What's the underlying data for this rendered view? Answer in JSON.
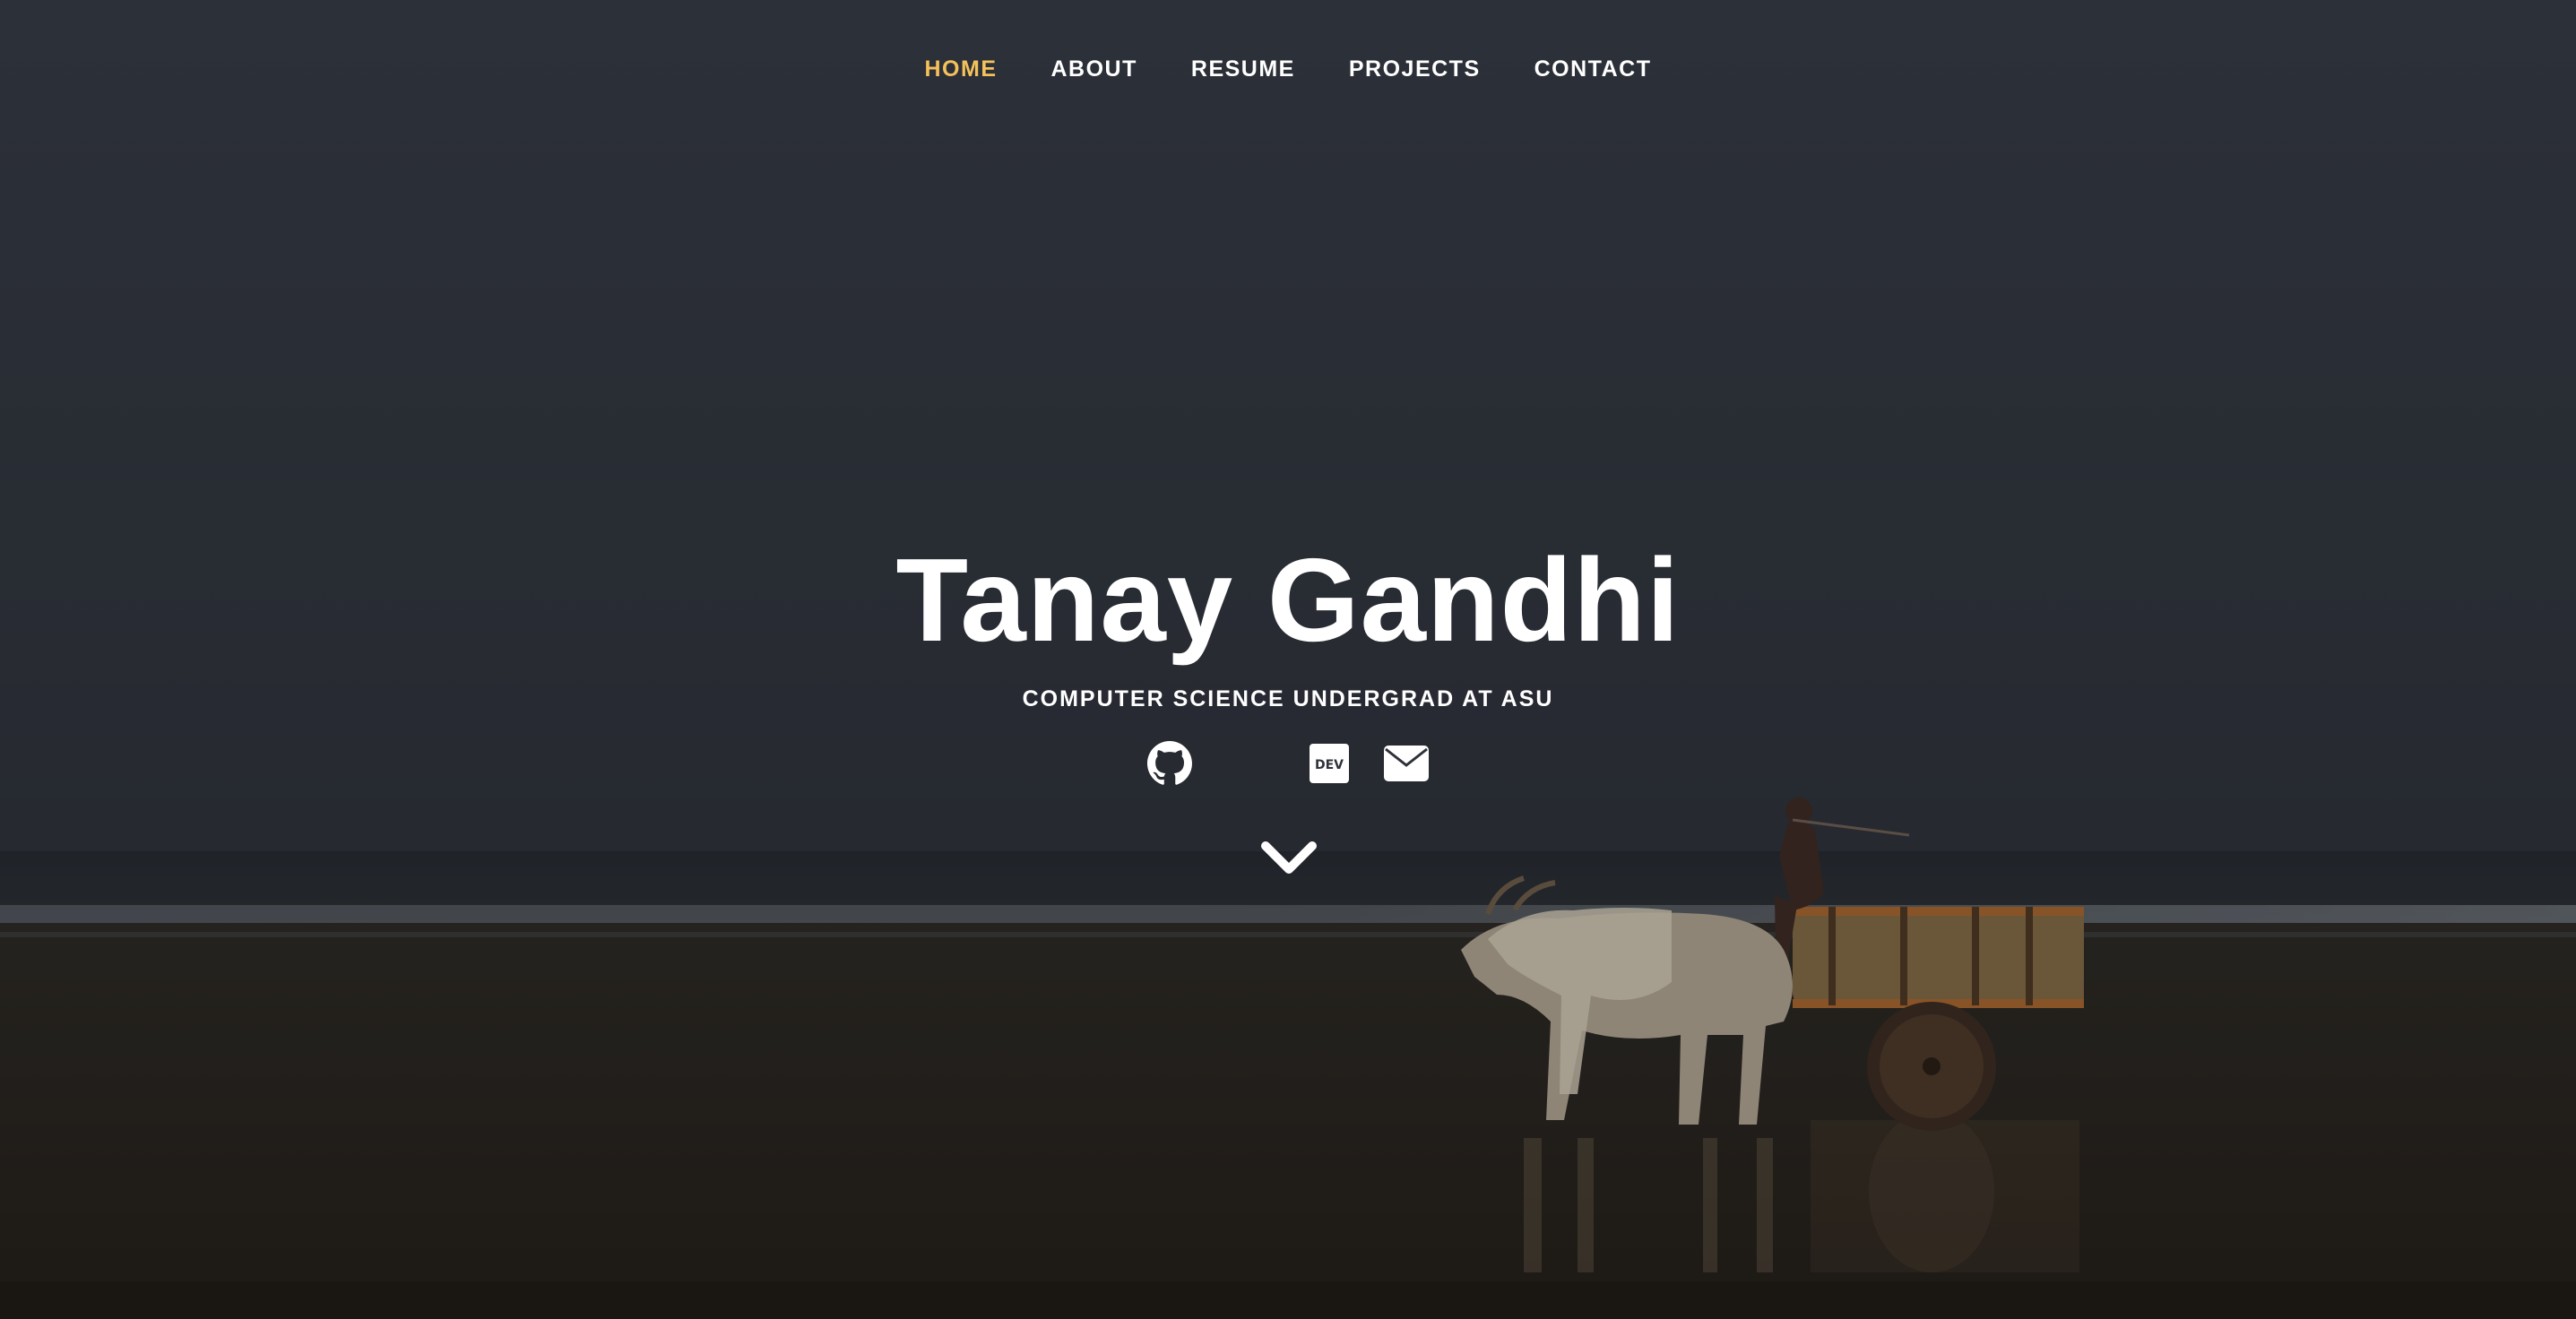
{
  "nav": {
    "items": [
      {
        "label": "HOME",
        "active": true
      },
      {
        "label": "ABOUT",
        "active": false
      },
      {
        "label": "RESUME",
        "active": false
      },
      {
        "label": "PROJECTS",
        "active": false
      },
      {
        "label": "CONTACT",
        "active": false
      }
    ]
  },
  "banner": {
    "name": "Tanay Gandhi",
    "tagline": "COMPUTER SCIENCE UNDERGRAD AT ASU"
  },
  "social": [
    {
      "icon": "github-icon"
    },
    {
      "icon": "linkedin-icon"
    },
    {
      "icon": "dev-icon",
      "text": "DEV"
    },
    {
      "icon": "envelope-icon"
    }
  ],
  "scroll": {
    "icon": "chevron-down-icon"
  },
  "colors": {
    "active_nav": "#f4c15a",
    "text": "#ffffff",
    "sky": "#30353f",
    "sand": "#2a2622"
  }
}
